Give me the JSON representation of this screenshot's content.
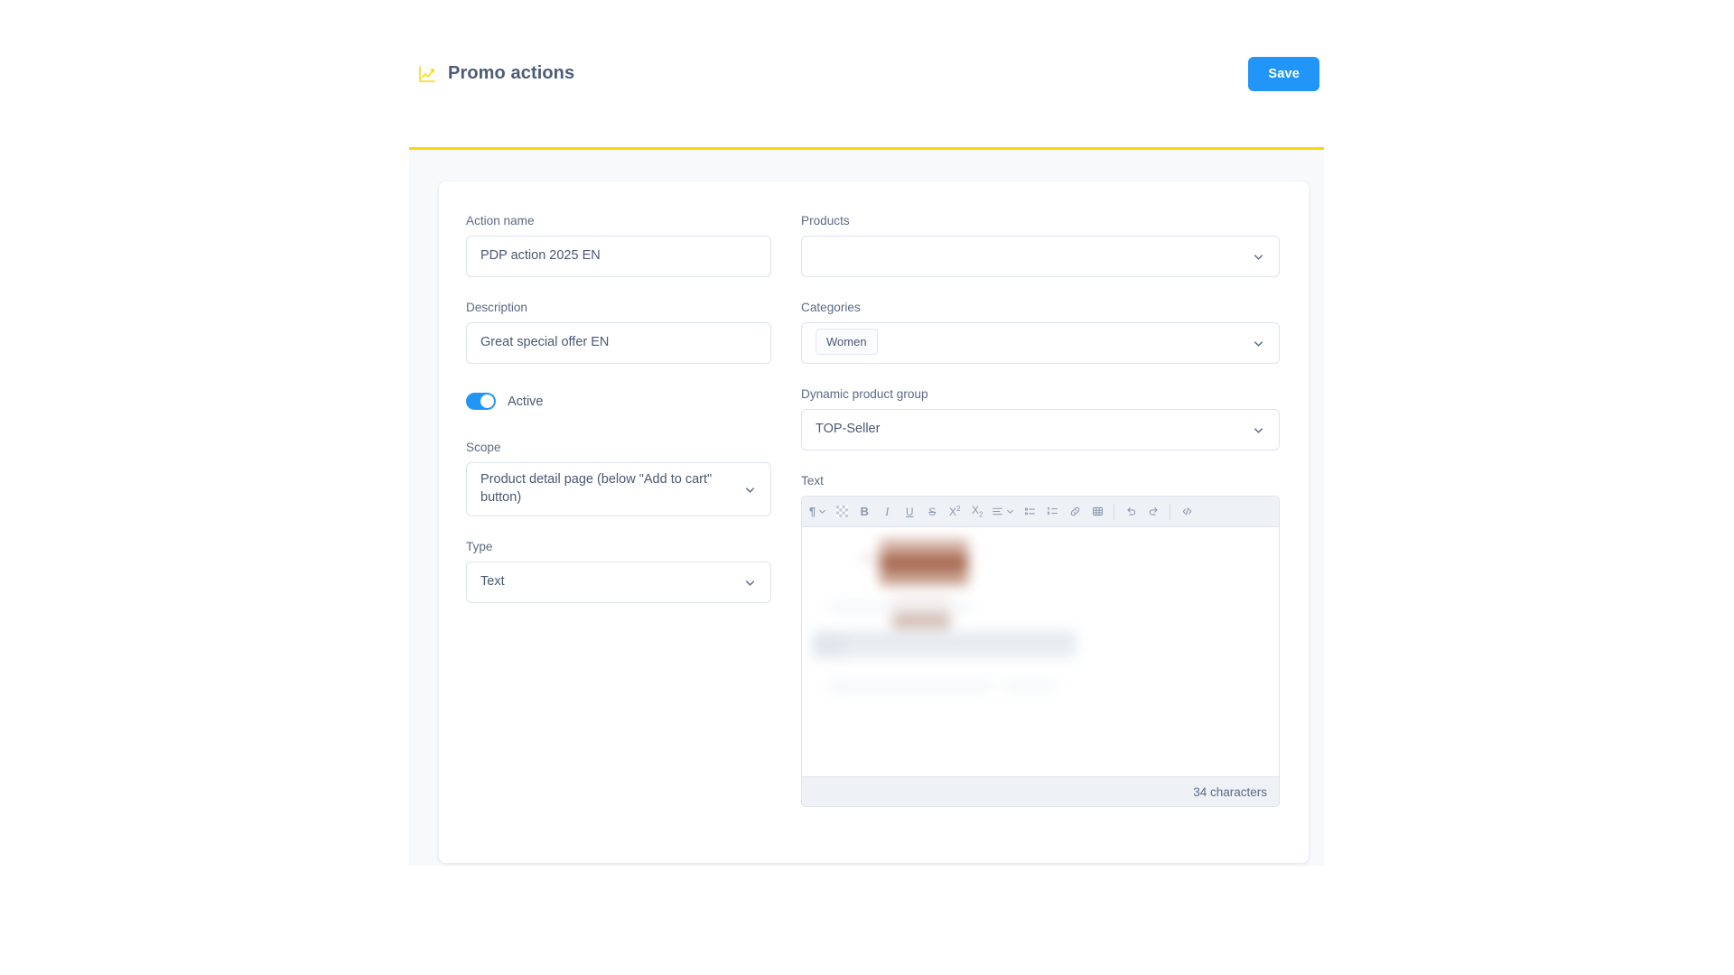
{
  "header": {
    "icon": "line-chart-icon",
    "title": "Promo actions",
    "save_label": "Save",
    "accent_color": "#fbd708",
    "primary_color": "#2196f8"
  },
  "form": {
    "left": {
      "action_name": {
        "label": "Action name",
        "value": "PDP action 2025 EN"
      },
      "description": {
        "label": "Description",
        "value": "Great special offer EN"
      },
      "active": {
        "label": "Active",
        "checked": true
      },
      "scope": {
        "label": "Scope",
        "value": "Product detail page (below \"Add to cart\" button)"
      },
      "type": {
        "label": "Type",
        "value": "Text"
      }
    },
    "right": {
      "products": {
        "label": "Products",
        "value": "",
        "placeholder": ""
      },
      "categories": {
        "label": "Categories",
        "tags": [
          "Women"
        ]
      },
      "dynamic_product_group": {
        "label": "Dynamic product group",
        "value": "TOP-Seller"
      },
      "text": {
        "label": "Text",
        "character_count": "34 characters",
        "content_redacted": true,
        "toolbar": [
          {
            "name": "paragraph-format-icon",
            "label": "¶",
            "has_chevron": true
          },
          {
            "name": "text-color-icon",
            "label": "",
            "has_chevron": false
          },
          {
            "name": "bold-icon",
            "label": "B",
            "has_chevron": false
          },
          {
            "name": "italic-icon",
            "label": "I",
            "has_chevron": false
          },
          {
            "name": "underline-icon",
            "label": "U",
            "has_chevron": false
          },
          {
            "name": "strikethrough-icon",
            "label": "S",
            "has_chevron": false
          },
          {
            "name": "superscript-icon",
            "label": "X",
            "has_chevron": false
          },
          {
            "name": "subscript-icon",
            "label": "X",
            "has_chevron": false
          },
          {
            "name": "align-icon",
            "label": "",
            "has_chevron": true
          },
          {
            "name": "bullet-list-icon",
            "label": "",
            "has_chevron": false
          },
          {
            "name": "numbered-list-icon",
            "label": "",
            "has_chevron": false
          },
          {
            "name": "link-icon",
            "label": "",
            "has_chevron": false
          },
          {
            "name": "table-icon",
            "label": "",
            "has_chevron": false
          },
          {
            "name": "undo-icon",
            "label": "",
            "has_chevron": false
          },
          {
            "name": "redo-icon",
            "label": "",
            "has_chevron": false
          },
          {
            "name": "source-code-icon",
            "label": "",
            "has_chevron": false
          }
        ]
      }
    }
  }
}
